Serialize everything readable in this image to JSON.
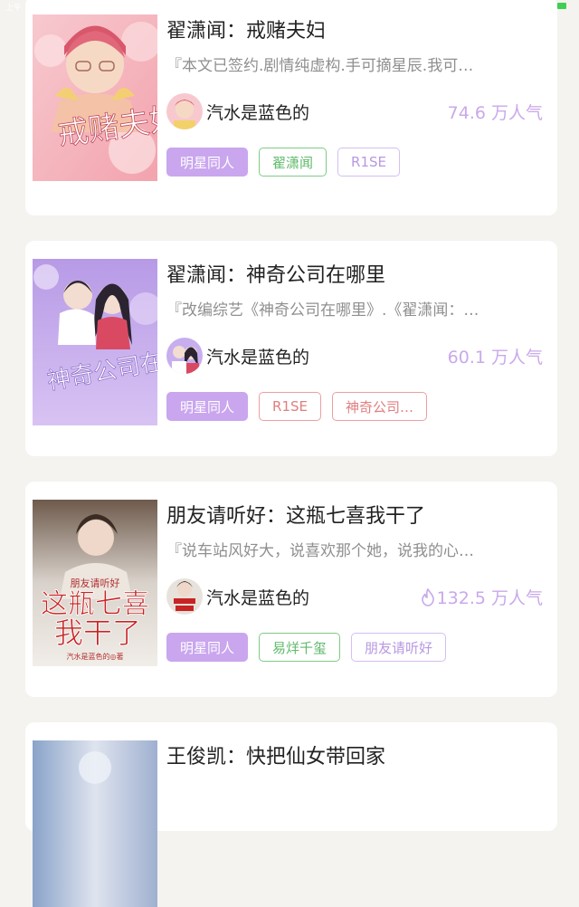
{
  "status": {
    "time": "上午"
  },
  "books": [
    {
      "title": "翟潇闻：戒赌夫妇",
      "description": "『本文已签约.剧情纯虚构.手可摘星辰.我可…",
      "author": "汽水是蓝色的",
      "popularity": "74.6 万人气",
      "cover_text": "戒赌夫妇",
      "tags": [
        "明星同人",
        "翟潇闻",
        "R1SE"
      ]
    },
    {
      "title": "翟潇闻：神奇公司在哪里",
      "description": "『改编综艺《神奇公司在哪里》.《翟潇闻：…",
      "author": "汽水是蓝色的",
      "popularity": "60.1 万人气",
      "cover_text": "神奇公司在哪里",
      "tags": [
        "明星同人",
        "R1SE",
        "神奇公司…"
      ]
    },
    {
      "title": "朋友请听好：这瓶七喜我干了",
      "description": "『说车站风好大，说喜欢那个她，说我的心…",
      "author": "汽水是蓝色的",
      "popularity": "132.5 万人气",
      "cover_text_top": "朋友请听好",
      "cover_text_main1": "这瓶七喜",
      "cover_text_main2": "我干了",
      "cover_text_bottom": "汽水是蓝色的◎著",
      "tags": [
        "明星同人",
        "易烊千玺",
        "朋友请听好"
      ]
    },
    {
      "title": "王俊凯：快把仙女带回家"
    }
  ]
}
